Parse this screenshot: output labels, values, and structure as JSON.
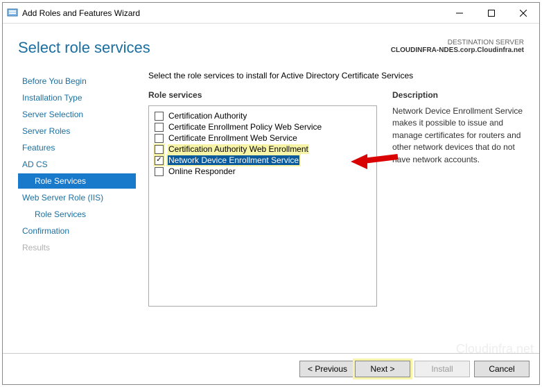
{
  "window": {
    "title": "Add Roles and Features Wizard"
  },
  "header": {
    "page_title": "Select role services",
    "dest_label": "DESTINATION SERVER",
    "dest_value": "CLOUDINFRA-NDES.corp.Cloudinfra.net"
  },
  "sidebar": {
    "items": [
      {
        "label": "Before You Begin",
        "child": false,
        "selected": false,
        "disabled": false
      },
      {
        "label": "Installation Type",
        "child": false,
        "selected": false,
        "disabled": false
      },
      {
        "label": "Server Selection",
        "child": false,
        "selected": false,
        "disabled": false
      },
      {
        "label": "Server Roles",
        "child": false,
        "selected": false,
        "disabled": false
      },
      {
        "label": "Features",
        "child": false,
        "selected": false,
        "disabled": false
      },
      {
        "label": "AD CS",
        "child": false,
        "selected": false,
        "disabled": false
      },
      {
        "label": "Role Services",
        "child": true,
        "selected": true,
        "disabled": false
      },
      {
        "label": "Web Server Role (IIS)",
        "child": false,
        "selected": false,
        "disabled": false
      },
      {
        "label": "Role Services",
        "child": true,
        "selected": false,
        "disabled": false
      },
      {
        "label": "Confirmation",
        "child": false,
        "selected": false,
        "disabled": false
      },
      {
        "label": "Results",
        "child": false,
        "selected": false,
        "disabled": true
      }
    ]
  },
  "main": {
    "intro": "Select the role services to install for Active Directory Certificate Services",
    "role_services_label": "Role services",
    "description_label": "Description",
    "description_text": "Network Device Enrollment Service makes it possible to issue and manage certificates for routers and other network devices that do not have network accounts.",
    "items": [
      {
        "label": "Certification Authority",
        "checked": false,
        "highlight": false,
        "selected": false
      },
      {
        "label": "Certificate Enrollment Policy Web Service",
        "checked": false,
        "highlight": false,
        "selected": false
      },
      {
        "label": "Certificate Enrollment Web Service",
        "checked": false,
        "highlight": false,
        "selected": false
      },
      {
        "label": "Certification Authority Web Enrollment",
        "checked": false,
        "highlight": true,
        "selected": false
      },
      {
        "label": "Network Device Enrollment Service",
        "checked": true,
        "highlight": true,
        "selected": true
      },
      {
        "label": "Online Responder",
        "checked": false,
        "highlight": false,
        "selected": false
      }
    ]
  },
  "footer": {
    "previous": "< Previous",
    "next": "Next >",
    "install": "Install",
    "cancel": "Cancel"
  },
  "watermark": "Cloudinfra.net"
}
